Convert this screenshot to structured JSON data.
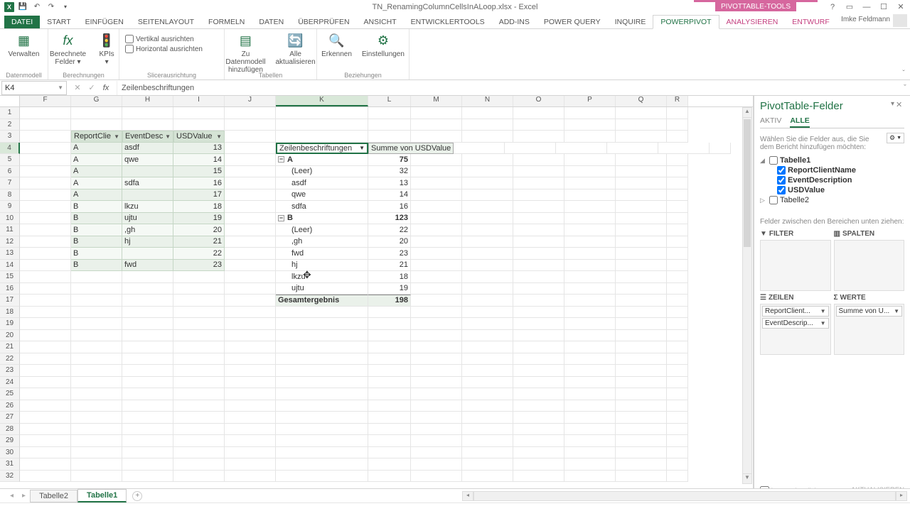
{
  "title": "TN_RenamingColumnCellsInALoop.xlsx - Excel",
  "pt_tools": "PIVOTTABLE-TOOLS",
  "user": "Imke Feldmann",
  "tabs": [
    "DATEI",
    "START",
    "EINFÜGEN",
    "SEITENLAYOUT",
    "FORMELN",
    "DATEN",
    "ÜBERPRÜFEN",
    "ANSICHT",
    "ENTWICKLERTOOLS",
    "ADD-INS",
    "POWER QUERY",
    "INQUIRE",
    "POWERPIVOT",
    "ANALYSIEREN",
    "ENTWURF"
  ],
  "ribbon": {
    "verwalten": "Verwalten",
    "datenmodell_grp": "Datenmodell",
    "ber_felder": "Berechnete\nFelder ▾",
    "kpis": "KPIs\n▾",
    "berechnungen_grp": "Berechnungen",
    "vert": "Vertikal ausrichten",
    "horz": "Horizontal ausrichten",
    "slicer_grp": "Slicerausrichtung",
    "zu_dm": "Zu Datenmodell\nhinzufügen",
    "alle_akt": "Alle\naktualisieren",
    "tabellen_grp": "Tabellen",
    "erkennen": "Erkennen",
    "einstellungen": "Einstellungen",
    "beziehungen_grp": "Beziehungen"
  },
  "namebox": "K4",
  "formula": "Zeilenbeschriftungen",
  "cols": [
    "F",
    "G",
    "H",
    "I",
    "J",
    "K",
    "L",
    "M",
    "N",
    "O",
    "P",
    "Q",
    "R"
  ],
  "table": {
    "hdr": [
      "ReportClie",
      "EventDesc",
      "USDValue"
    ],
    "rows": [
      [
        "A",
        "asdf",
        "13"
      ],
      [
        "A",
        "qwe",
        "14"
      ],
      [
        "A",
        "",
        "15"
      ],
      [
        "A",
        "sdfa",
        "16"
      ],
      [
        "A",
        "",
        "17"
      ],
      [
        "B",
        "lkzu",
        "18"
      ],
      [
        "B",
        "ujtu",
        "19"
      ],
      [
        "B",
        ",gh",
        "20"
      ],
      [
        "B",
        "hj",
        "21"
      ],
      [
        "B",
        "",
        "22"
      ],
      [
        "B",
        "fwd",
        "23"
      ]
    ]
  },
  "pivot": {
    "rowlbl": "Zeilenbeschriftungen",
    "vallbl": "Summe von USDValue",
    "groups": [
      {
        "name": "A",
        "sum": "75",
        "items": [
          [
            "(Leer)",
            "32"
          ],
          [
            "asdf",
            "13"
          ],
          [
            "qwe",
            "14"
          ],
          [
            "sdfa",
            "16"
          ]
        ]
      },
      {
        "name": "B",
        "sum": "123",
        "items": [
          [
            "(Leer)",
            "22"
          ],
          [
            ",gh",
            "20"
          ],
          [
            "fwd",
            "23"
          ],
          [
            "hj",
            "21"
          ],
          [
            "lkzu",
            "18"
          ],
          [
            "ujtu",
            "19"
          ]
        ]
      }
    ],
    "total_lbl": "Gesamtergebnis",
    "total_val": "198"
  },
  "pane": {
    "title": "PivotTable-Felder",
    "tabs": [
      "AKTIV",
      "ALLE"
    ],
    "hint": "Wählen Sie die Felder aus, die Sie dem Bericht hinzufügen möchten:",
    "tree": {
      "tabelle1": "Tabelle1",
      "fields": [
        "ReportClientName",
        "EventDescription",
        "USDValue"
      ],
      "tabelle2": "Tabelle2"
    },
    "between": "Felder zwischen den Bereichen unten ziehen:",
    "filter": "FILTER",
    "spalten": "SPALTEN",
    "zeilen": "ZEILEN",
    "werte": "WERTE",
    "zeilen_items": [
      "ReportClient...",
      "EventDescrip..."
    ],
    "werte_items": [
      "Summe von U..."
    ],
    "defer": "Layoutaktualisieru...",
    "update": "AKTUALISIEREN"
  },
  "sheets": [
    "Tabelle2",
    "Tabelle1"
  ]
}
